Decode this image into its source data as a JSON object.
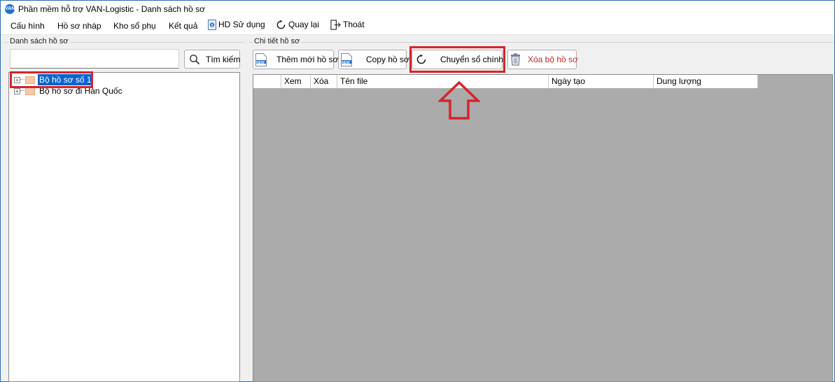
{
  "window": {
    "title": "Phần mềm hỗ trợ VAN-Logistic - Danh sách hồ sơ",
    "app_icon_text": "VAN"
  },
  "menu": {
    "items": [
      "Cấu hình",
      "Hồ sơ nháp",
      "Kho sổ phụ",
      "Kết quả"
    ],
    "help": "HD Sử dụng",
    "back": "Quay lại",
    "exit": "Thoát"
  },
  "left_panel": {
    "group_label": "Danh sách hồ sơ",
    "search_value": "",
    "search_button": "Tìm kiếm",
    "tree": [
      {
        "label": "Bộ hồ sơ số 1",
        "selected": true
      },
      {
        "label": "Bộ hồ sơ đi Hàn Quốc",
        "selected": false
      }
    ]
  },
  "right_panel": {
    "group_label": "Chi tiết hồ sơ",
    "toolbar": {
      "add_new": "Thêm mới hồ sơ",
      "copy": "Copy hồ sơ",
      "convert": "Chuyển sổ chính",
      "delete": "Xóa bộ hồ sơ",
      "new_badge": "NEW"
    },
    "grid_columns": [
      "",
      "Xem",
      "Xóa",
      "Tên file",
      "Ngày tạo",
      "Dung lượng"
    ]
  },
  "colors": {
    "highlight": "#d8232a",
    "selection": "#0a64cf",
    "grid_background": "#ababab",
    "delete_text": "#c62828"
  }
}
